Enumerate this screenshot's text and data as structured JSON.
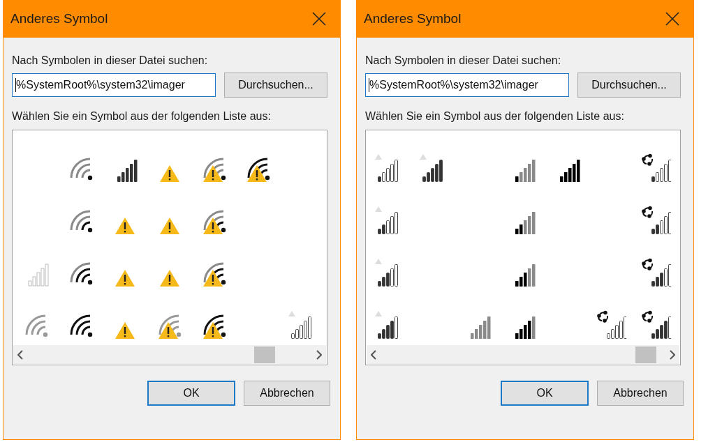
{
  "dialogs": [
    {
      "title": "Anderes Symbol",
      "search_label": "Nach Symbolen in dieser Datei suchen:",
      "path_field": {
        "value": "%SystemRoot%\\system32\\imager"
      },
      "browse_button": "Durchsuchen...",
      "list_label": "Wählen Sie ein Symbol aus der folgenden Liste aus:",
      "icon_rows": [
        [
          {
            "kind": "empty"
          },
          {
            "kind": "wifi-0"
          },
          {
            "kind": "bars-dark"
          },
          {
            "kind": "warn"
          },
          {
            "kind": "wifi-0-warn"
          },
          {
            "kind": "wifi-3-warn"
          },
          {
            "kind": "empty"
          }
        ],
        [
          {
            "kind": "empty"
          },
          {
            "kind": "wifi-1"
          },
          {
            "kind": "warn"
          },
          {
            "kind": "warn"
          },
          {
            "kind": "wifi-1-warn"
          },
          {
            "kind": "empty"
          },
          {
            "kind": "empty"
          }
        ],
        [
          {
            "kind": "bars-faint"
          },
          {
            "kind": "wifi-2"
          },
          {
            "kind": "warn"
          },
          {
            "kind": "warn"
          },
          {
            "kind": "wifi-2-warn"
          },
          {
            "kind": "empty"
          },
          {
            "kind": "empty"
          }
        ],
        [
          {
            "kind": "wifi-dim"
          },
          {
            "kind": "wifi-3"
          },
          {
            "kind": "warn"
          },
          {
            "kind": "wifi-dim-warn"
          },
          {
            "kind": "wifi-3-warn"
          },
          {
            "kind": "empty"
          },
          {
            "kind": "tri-0"
          }
        ]
      ],
      "buttons": [
        {
          "label": "OK",
          "default": true
        },
        {
          "label": "Abbrechen",
          "default": false
        }
      ]
    },
    {
      "title": "Anderes Symbol",
      "search_label": "Nach Symbolen in dieser Datei suchen:",
      "path_field": {
        "value": "%SystemRoot%\\system32\\imager"
      },
      "browse_button": "Durchsuchen...",
      "list_label": "Wählen Sie ein Symbol aus der folgenden Liste aus:",
      "icon_rows": [
        [
          {
            "kind": "tri-1"
          },
          {
            "kind": "tri-5"
          },
          {
            "kind": "empty"
          },
          {
            "kind": "sig-1"
          },
          {
            "kind": "sig-5"
          },
          {
            "kind": "empty"
          },
          {
            "kind": "cyc-1"
          }
        ],
        [
          {
            "kind": "tri-2"
          },
          {
            "kind": "empty"
          },
          {
            "kind": "empty"
          },
          {
            "kind": "sig-2"
          },
          {
            "kind": "empty"
          },
          {
            "kind": "empty"
          },
          {
            "kind": "cyc-2"
          }
        ],
        [
          {
            "kind": "tri-3"
          },
          {
            "kind": "empty"
          },
          {
            "kind": "empty"
          },
          {
            "kind": "sig-3"
          },
          {
            "kind": "empty"
          },
          {
            "kind": "empty"
          },
          {
            "kind": "cyc-3"
          }
        ],
        [
          {
            "kind": "tri-4"
          },
          {
            "kind": "empty"
          },
          {
            "kind": "sig-0"
          },
          {
            "kind": "sig-4"
          },
          {
            "kind": "empty"
          },
          {
            "kind": "cyc-0"
          },
          {
            "kind": "cyc-4"
          }
        ]
      ],
      "buttons": [
        {
          "label": "OK",
          "default": true
        },
        {
          "label": "Abbrechen",
          "default": false
        }
      ]
    }
  ]
}
